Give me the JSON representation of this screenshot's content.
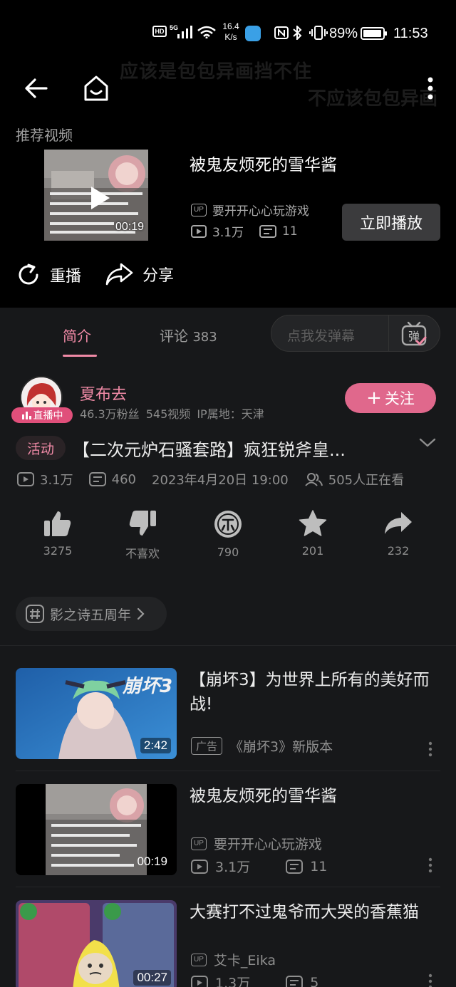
{
  "status_bar": {
    "hd_label": "HD",
    "network_label": "5G",
    "net_speed_value": "16.4",
    "net_speed_unit": "K/s",
    "battery_percent": "89%",
    "time": "11:53"
  },
  "player": {
    "ghost_text_1": "应该是包包异画挡不住",
    "ghost_text_2": "不应该包包异画",
    "recommended_heading": "推荐视频",
    "recommended": {
      "title": "被鬼友烦死的雪华酱",
      "duration": "00:19",
      "up_tag": "UP",
      "uploader": "要开开心心玩游戏",
      "views": "3.1万",
      "danmaku": "11",
      "play_now_label": "立即播放"
    },
    "replay_label": "重播",
    "share_label": "分享"
  },
  "tabs": {
    "intro_label": "简介",
    "comments_label": "评论",
    "comments_count": "383",
    "danmaku_placeholder": "点我发弹幕",
    "danmaku_toggle_char": "弹"
  },
  "uploader": {
    "name": "夏布去",
    "live_label": "直播中",
    "meta": "46.3万粉丝  545视频  IP属地：天津",
    "follow_label": "关注",
    "follow_prefix": "+"
  },
  "video": {
    "activity_tag": "活动",
    "title": "【二次元炉石骚套路】疯狂锐斧皇...",
    "views": "3.1万",
    "danmaku": "460",
    "publish_time": "2023年4月20日 19:00",
    "watching": "505人正在看"
  },
  "actions": [
    {
      "icon": "thumbs-up-icon",
      "label": "3275"
    },
    {
      "icon": "thumbs-down-icon",
      "label": "不喜欢"
    },
    {
      "icon": "coin-icon",
      "label": "790"
    },
    {
      "icon": "star-icon",
      "label": "201"
    },
    {
      "icon": "share-forward-icon",
      "label": "232"
    }
  ],
  "topic": {
    "label": "影之诗五周年"
  },
  "related": [
    {
      "title": "【崩坏3】为世界上所有的美好而战!",
      "duration": "2:42",
      "ad_tag": "广告",
      "subtitle": "《崩坏3》新版本"
    },
    {
      "title": "被鬼友烦死的雪华酱",
      "duration": "00:19",
      "up_tag": "UP",
      "uploader": "要开开心心玩游戏",
      "views": "3.1万",
      "danmaku": "11"
    },
    {
      "title": "大赛打不过鬼爷而大哭的香蕉猫",
      "duration": "00:27",
      "up_tag": "UP",
      "uploader": "艾卡_Eika",
      "views": "1.3万",
      "danmaku": "5"
    }
  ],
  "colors": {
    "accent_pink": "#f08aa6",
    "follow_pink": "#e0688c",
    "live_badge": "#e04f7a",
    "background": "#17181a"
  }
}
